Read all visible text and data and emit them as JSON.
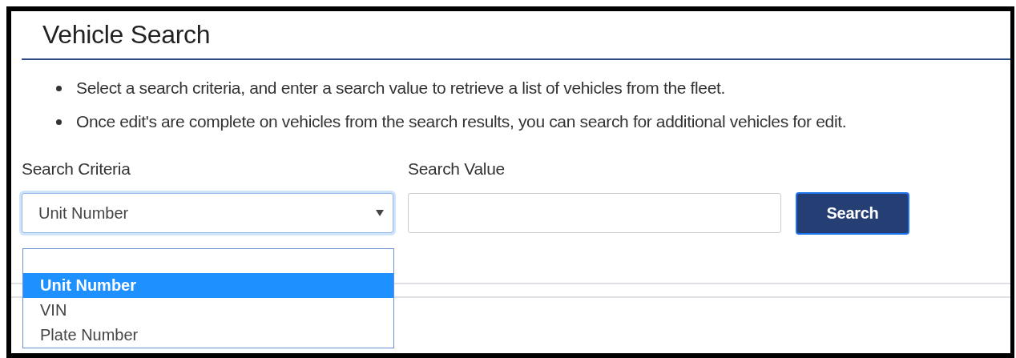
{
  "header": {
    "title": "Vehicle Search"
  },
  "instructions": [
    "Select a search criteria, and enter a search value to retrieve a list of vehicles from the fleet.",
    "Once edit's are complete on vehicles from the search results, you can search for additional vehicles for edit."
  ],
  "criteria": {
    "label": "Search Criteria",
    "value": "Unit Number",
    "expanded": true,
    "options": [
      {
        "label": "Unit Number",
        "selected": true
      },
      {
        "label": "VIN",
        "selected": false
      },
      {
        "label": "Plate Number",
        "selected": false
      }
    ]
  },
  "search_value": {
    "label": "Search Value"
  },
  "search_button": {
    "label": "Search"
  }
}
